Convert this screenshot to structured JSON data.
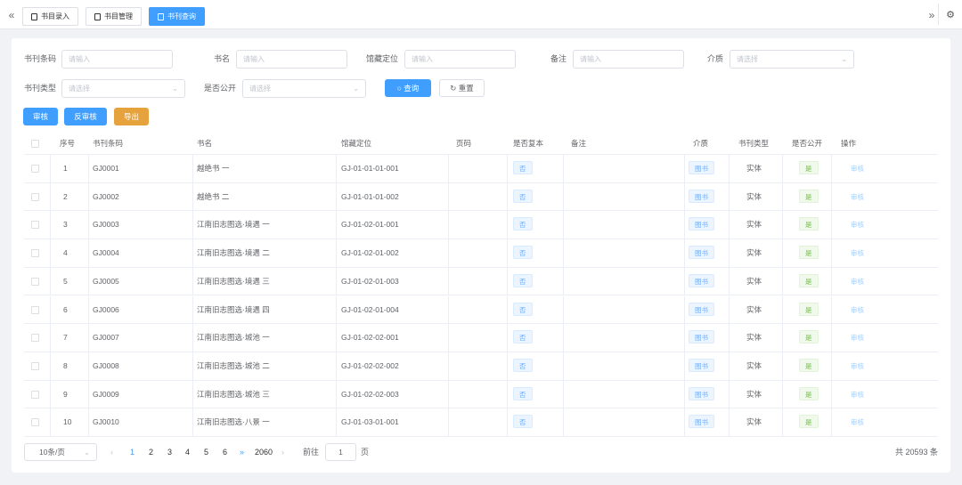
{
  "tabs": [
    {
      "label": "书目录入",
      "active": false
    },
    {
      "label": "书目管理",
      "active": false
    },
    {
      "label": "书刊查询",
      "active": true
    }
  ],
  "filters": {
    "barcode": {
      "label": "书刊条码",
      "placeholder": "请输入"
    },
    "title": {
      "label": "书名",
      "placeholder": "请输入"
    },
    "location": {
      "label": "馆藏定位",
      "placeholder": "请输入"
    },
    "remark": {
      "label": "备注",
      "placeholder": "请输入"
    },
    "medium": {
      "label": "介质",
      "placeholder": "请选择"
    },
    "type": {
      "label": "书刊类型",
      "placeholder": "请选择"
    },
    "public": {
      "label": "是否公开",
      "placeholder": "请选择"
    },
    "query_label": "查询",
    "reset_label": "重置"
  },
  "actions": {
    "approve": "审核",
    "unapprove": "反审核",
    "export": "导出"
  },
  "table": {
    "headers": {
      "index": "序号",
      "barcode": "书刊条码",
      "title": "书名",
      "location": "馆藏定位",
      "pages": "页码",
      "rare": "是否复本",
      "remark": "备注",
      "medium": "介质",
      "type": "书刊类型",
      "public": "是否公开",
      "ops": "操作"
    },
    "rows": [
      {
        "index": "1",
        "barcode": "GJ0001",
        "title": "越绝书 一",
        "location": "GJ-01-01-01-001",
        "rare": "否",
        "medium": "图书",
        "type": "实体",
        "public": "是",
        "op": "审核"
      },
      {
        "index": "2",
        "barcode": "GJ0002",
        "title": "越绝书 二",
        "location": "GJ-01-01-01-002",
        "rare": "否",
        "medium": "图书",
        "type": "实体",
        "public": "是",
        "op": "审核"
      },
      {
        "index": "3",
        "barcode": "GJ0003",
        "title": "江南旧志图选·境遇 一",
        "location": "GJ-01-02-01-001",
        "rare": "否",
        "medium": "图书",
        "type": "实体",
        "public": "是",
        "op": "审核"
      },
      {
        "index": "4",
        "barcode": "GJ0004",
        "title": "江南旧志图选·境遇 二",
        "location": "GJ-01-02-01-002",
        "rare": "否",
        "medium": "图书",
        "type": "实体",
        "public": "是",
        "op": "审核"
      },
      {
        "index": "5",
        "barcode": "GJ0005",
        "title": "江南旧志图选·境遇 三",
        "location": "GJ-01-02-01-003",
        "rare": "否",
        "medium": "图书",
        "type": "实体",
        "public": "是",
        "op": "审核"
      },
      {
        "index": "6",
        "barcode": "GJ0006",
        "title": "江南旧志图选·境遇 四",
        "location": "GJ-01-02-01-004",
        "rare": "否",
        "medium": "图书",
        "type": "实体",
        "public": "是",
        "op": "审核"
      },
      {
        "index": "7",
        "barcode": "GJ0007",
        "title": "江南旧志图选·城池 一",
        "location": "GJ-01-02-02-001",
        "rare": "否",
        "medium": "图书",
        "type": "实体",
        "public": "是",
        "op": "审核"
      },
      {
        "index": "8",
        "barcode": "GJ0008",
        "title": "江南旧志图选·城池 二",
        "location": "GJ-01-02-02-002",
        "rare": "否",
        "medium": "图书",
        "type": "实体",
        "public": "是",
        "op": "审核"
      },
      {
        "index": "9",
        "barcode": "GJ0009",
        "title": "江南旧志图选·城池 三",
        "location": "GJ-01-02-02-003",
        "rare": "否",
        "medium": "图书",
        "type": "实体",
        "public": "是",
        "op": "审核"
      },
      {
        "index": "10",
        "barcode": "GJ0010",
        "title": "江南旧志图选·八景 一",
        "location": "GJ-01-03-01-001",
        "rare": "否",
        "medium": "图书",
        "type": "实体",
        "public": "是",
        "op": "审核"
      }
    ]
  },
  "pagination": {
    "page_size": "10条/页",
    "pages": [
      "1",
      "2",
      "3",
      "4",
      "5",
      "6"
    ],
    "current": "1",
    "more": "»",
    "last": "2060",
    "goto_prefix": "前往",
    "goto_value": "1",
    "goto_suffix": "页",
    "total": "共 20593 条"
  },
  "colors": {
    "primary": "#409eff",
    "warning": "#e6a23c",
    "success": "#67c23a"
  }
}
